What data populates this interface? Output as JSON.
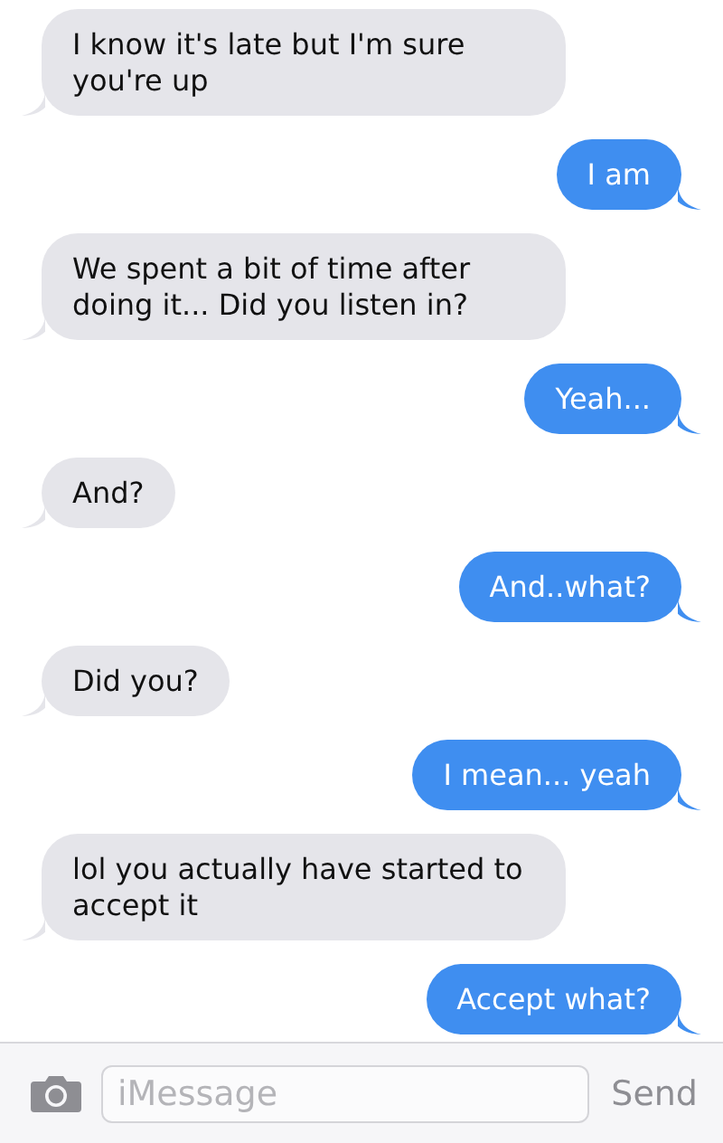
{
  "messages": [
    {
      "kind": "incoming",
      "text": "I know it's late but I'm sure you're up"
    },
    {
      "kind": "outgoing",
      "text": "I am"
    },
    {
      "kind": "incoming",
      "text": "We spent a bit of time after doing it... Did you listen in?"
    },
    {
      "kind": "outgoing",
      "text": "Yeah..."
    },
    {
      "kind": "incoming",
      "text": "And?"
    },
    {
      "kind": "outgoing",
      "text": "And..what?"
    },
    {
      "kind": "incoming",
      "text": "Did you?"
    },
    {
      "kind": "outgoing",
      "text": "I mean... yeah"
    },
    {
      "kind": "incoming",
      "text": "lol you actually have started to accept it"
    },
    {
      "kind": "outgoing",
      "text": "Accept what?"
    }
  ],
  "composer": {
    "placeholder": "iMessage",
    "send": "Send"
  }
}
